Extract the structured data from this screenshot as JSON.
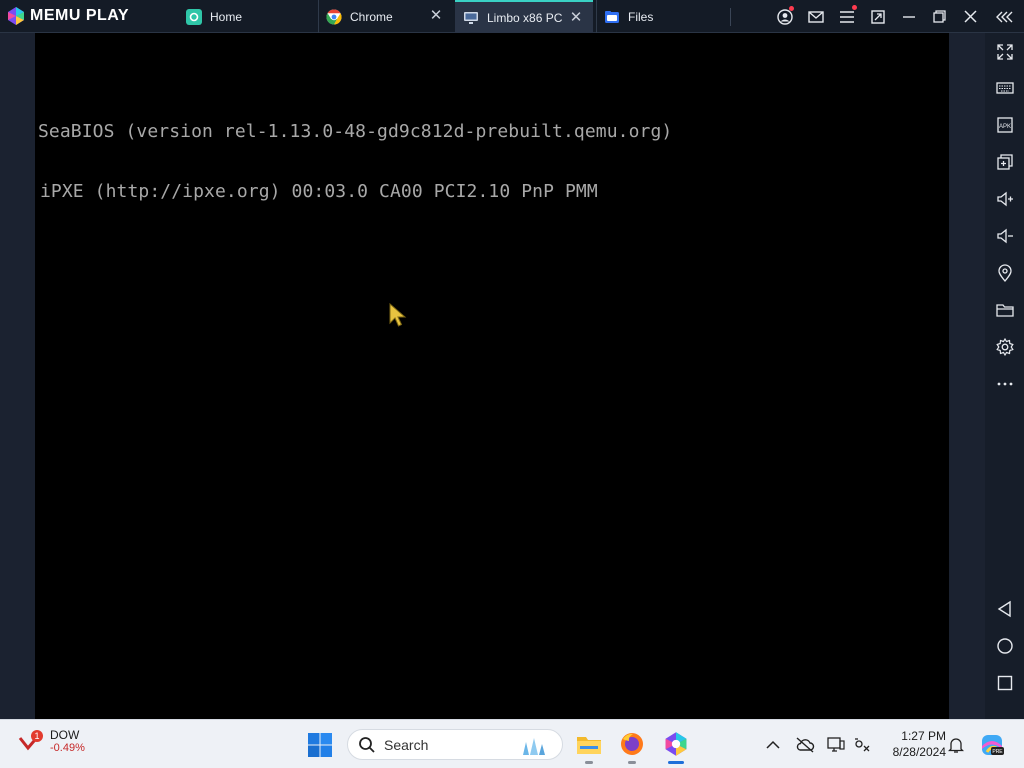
{
  "app": {
    "brand": "MEMU PLAY",
    "tabs": [
      {
        "label": "Home",
        "icon": "home-app-icon",
        "active": false,
        "closable": false
      },
      {
        "label": "Chrome",
        "icon": "chrome-icon",
        "active": false,
        "closable": true
      },
      {
        "label": "Limbo x86 PC",
        "icon": "monitor-icon",
        "active": true,
        "closable": true
      },
      {
        "label": "Files",
        "icon": "folder-icon",
        "active": false,
        "closable": false
      }
    ],
    "accent": "#3ad1c4"
  },
  "window_controls": [
    "account-icon",
    "mail-icon",
    "menu-icon",
    "restore-screen-icon",
    "minimize-icon",
    "maximize-icon",
    "close-icon",
    "collapse-sidebar-icon"
  ],
  "screen": {
    "bios_lines": [
      "SeaBIOS (version rel-1.13.0-48-gd9c812d-prebuilt.qemu.org)",
      "iPXE (http://ipxe.org) 00:03.0 CA00 PCI2.10 PnP PMM"
    ],
    "text_color": "#a8a8a8",
    "background": "#000000"
  },
  "sidebar_tools": [
    "fullscreen-icon",
    "keyboard-icon",
    "apk-icon",
    "multi-instance-icon",
    "volume-up-icon",
    "volume-down-icon",
    "location-icon",
    "folder-icon",
    "settings-icon",
    "more-icon",
    "back-icon",
    "home-icon",
    "recents-icon"
  ],
  "taskbar": {
    "stock": {
      "name": "DOW",
      "change": "-0.49%",
      "badge": "1"
    },
    "search_placeholder": "Search",
    "apps": [
      "file-explorer-icon",
      "firefox-icon",
      "memu-icon"
    ],
    "clock": {
      "time": "1:27 PM",
      "date": "8/28/2024"
    }
  }
}
